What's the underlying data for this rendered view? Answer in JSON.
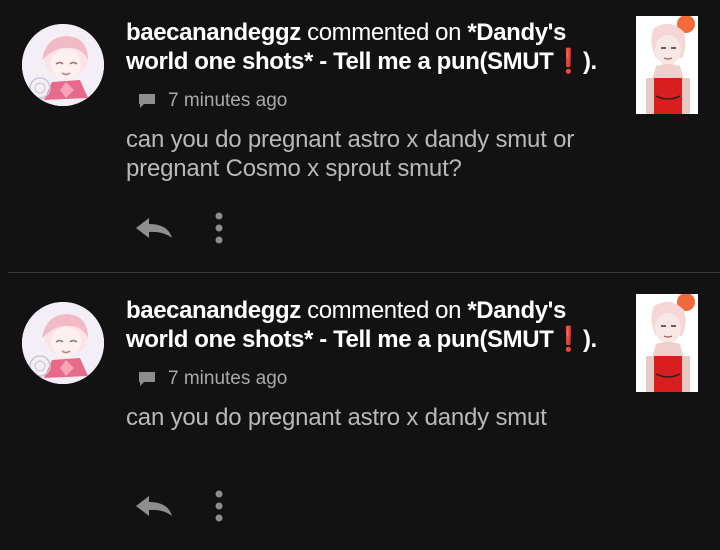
{
  "notifications": [
    {
      "username": "baecanandeggz",
      "action": " commented on ",
      "story_title": "*Dandy's world one shots* - Tell me a pun(SMUT",
      "title_mark": "❗",
      "title_end": ").",
      "timestamp": "7 minutes ago",
      "comment": "can you do pregnant astro x dandy smut or pregnant Cosmo x sprout smut?",
      "icons": {
        "avatar": "avatar-pink-hair",
        "comment": "comment-bubble-icon",
        "reply": "reply-arrow-icon",
        "more": "more-vertical-icon",
        "thumbnail": "story-cover"
      }
    },
    {
      "username": "baecanandeggz",
      "action": " commented on ",
      "story_title": "*Dandy's world one shots* - Tell me a pun(SMUT",
      "title_mark": "❗",
      "title_end": ").",
      "timestamp": "7 minutes ago",
      "comment": "can you do pregnant astro x dandy smut",
      "icons": {
        "avatar": "avatar-pink-hair",
        "comment": "comment-bubble-icon",
        "reply": "reply-arrow-icon",
        "more": "more-vertical-icon",
        "thumbnail": "story-cover"
      }
    }
  ],
  "colors": {
    "background": "#121212",
    "primary_text": "#ffffff",
    "secondary_text": "#a9a9a9",
    "comment_text": "#b9b9b9",
    "icon": "#8e8e8e",
    "alert": "#e53935",
    "divider": "#3a3a3a"
  }
}
